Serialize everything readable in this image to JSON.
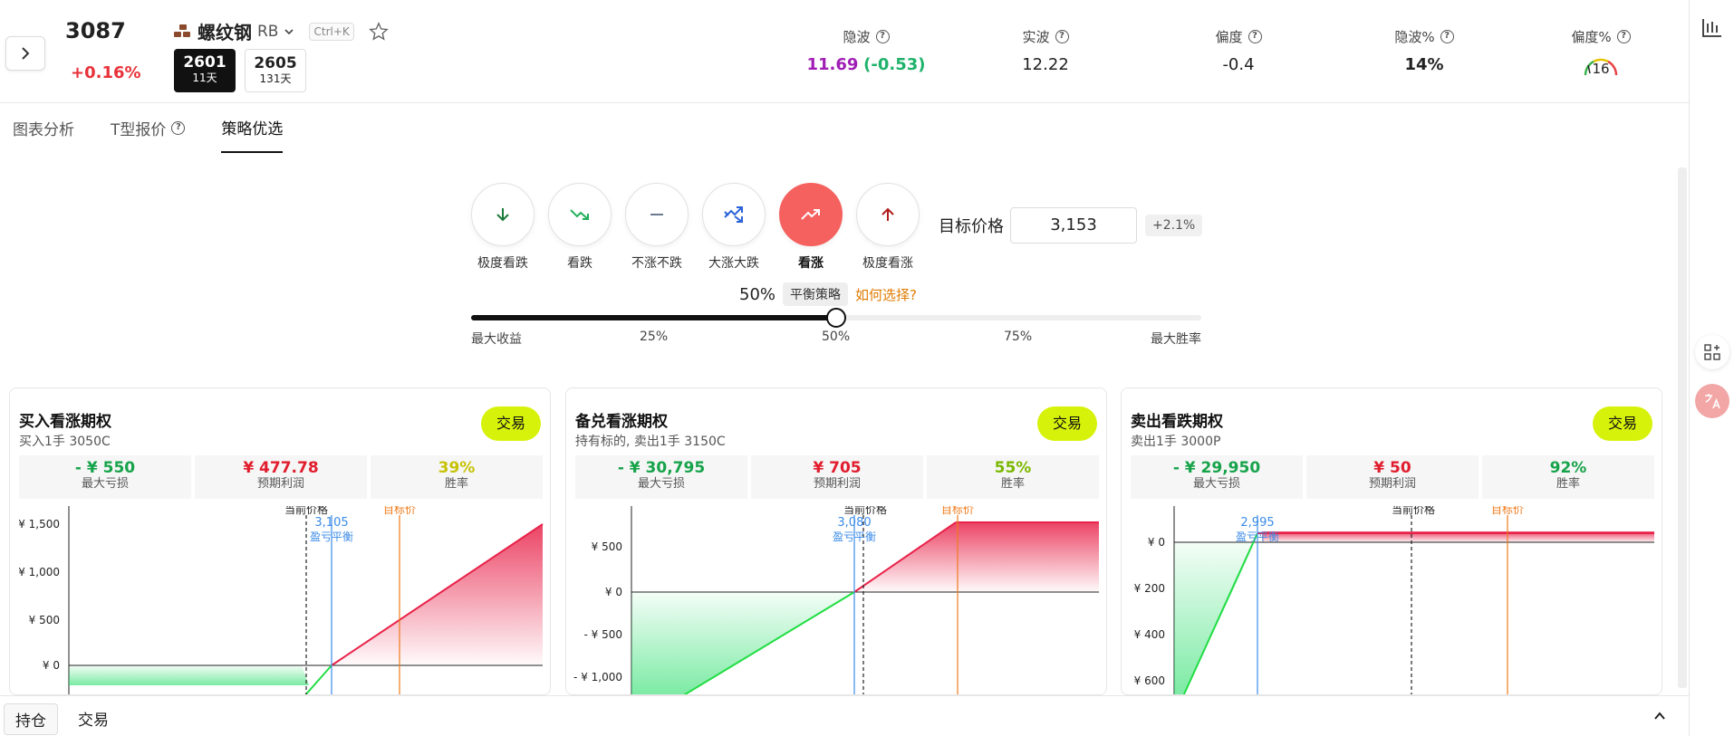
{
  "header": {
    "price": "3087",
    "change": "+0.16%",
    "product_name": "螺纹钢",
    "product_code": "RB",
    "shortcut": "Ctrl+K",
    "contracts": [
      {
        "code": "2601",
        "days": "11天"
      },
      {
        "code": "2605",
        "days": "131天"
      }
    ],
    "metrics": {
      "iv": {
        "label": "隐波",
        "value": "11.69",
        "delta": "(-0.53)"
      },
      "rv": {
        "label": "实波",
        "value": "12.22"
      },
      "skew": {
        "label": "偏度",
        "value": "-0.4"
      },
      "iv_pct": {
        "label": "隐波%",
        "value": "14%"
      },
      "skew_pct": {
        "label": "偏度%",
        "value": "16"
      }
    }
  },
  "tabs": [
    {
      "label": "图表分析"
    },
    {
      "label": "T型报价"
    },
    {
      "label": "策略优选"
    }
  ],
  "directions": [
    {
      "label": "极度看跌",
      "icon": "arrow-down-icon"
    },
    {
      "label": "看跌",
      "icon": "trend-down-icon"
    },
    {
      "label": "不涨不跌",
      "icon": "minus-icon"
    },
    {
      "label": "大涨大跌",
      "icon": "volatile-icon"
    },
    {
      "label": "看涨",
      "icon": "trend-up-icon"
    },
    {
      "label": "极度看涨",
      "icon": "arrow-up-icon"
    }
  ],
  "target": {
    "label": "目标价格",
    "value": "3,153",
    "pct": "+2.1%"
  },
  "balance": {
    "pct": "50%",
    "tag": "平衡策略",
    "link": "如何选择?",
    "value_fraction": 0.5
  },
  "slider_labels": [
    "最大收益",
    "25%",
    "50%",
    "75%",
    "最大胜率"
  ],
  "cards": [
    {
      "title": "买入看涨期权",
      "subtitle": "买入1手 3050C",
      "trade": "交易",
      "stats": [
        {
          "value": "- ¥ 550",
          "label": "最大亏损"
        },
        {
          "value": "¥ 477.78",
          "label": "预期利润"
        },
        {
          "value": "39%",
          "label": "胜率"
        }
      ]
    },
    {
      "title": "备兑看涨期权",
      "subtitle": "持有标的, 卖出1手 3150C",
      "trade": "交易",
      "stats": [
        {
          "value": "- ¥ 30,795",
          "label": "最大亏损"
        },
        {
          "value": "¥ 705",
          "label": "预期利润"
        },
        {
          "value": "55%",
          "label": "胜率"
        }
      ]
    },
    {
      "title": "卖出看跌期权",
      "subtitle": "卖出1手 3000P",
      "trade": "交易",
      "stats": [
        {
          "value": "- ¥ 29,950",
          "label": "最大亏损"
        },
        {
          "value": "¥ 50",
          "label": "预期利润"
        },
        {
          "value": "92%",
          "label": "胜率"
        }
      ]
    }
  ],
  "chart_data": [
    {
      "type": "line",
      "title": "",
      "y_ticks": [
        "¥ 1,500",
        "¥ 1,000",
        "¥ 500",
        "¥ 0"
      ],
      "annotations": [
        "当前价格",
        "3,105",
        "盈亏平衡",
        "目标价"
      ],
      "breakeven": 3105
    },
    {
      "type": "line",
      "title": "",
      "y_ticks": [
        "¥ 500",
        "¥ 0",
        "- ¥ 500",
        "- ¥ 1,000"
      ],
      "annotations": [
        "当前价格",
        "3,080",
        "盈亏平衡",
        "目标价"
      ],
      "breakeven": 3080
    },
    {
      "type": "line",
      "title": "",
      "y_ticks": [
        "¥ 0",
        "¥ 200",
        "¥ 400",
        "¥ 600"
      ],
      "annotations": [
        "当前价格",
        "2,995",
        "盈亏平衡",
        "目标价"
      ],
      "breakeven": 2995
    }
  ],
  "bottom": {
    "tab1": "持仓",
    "tab2": "交易"
  }
}
